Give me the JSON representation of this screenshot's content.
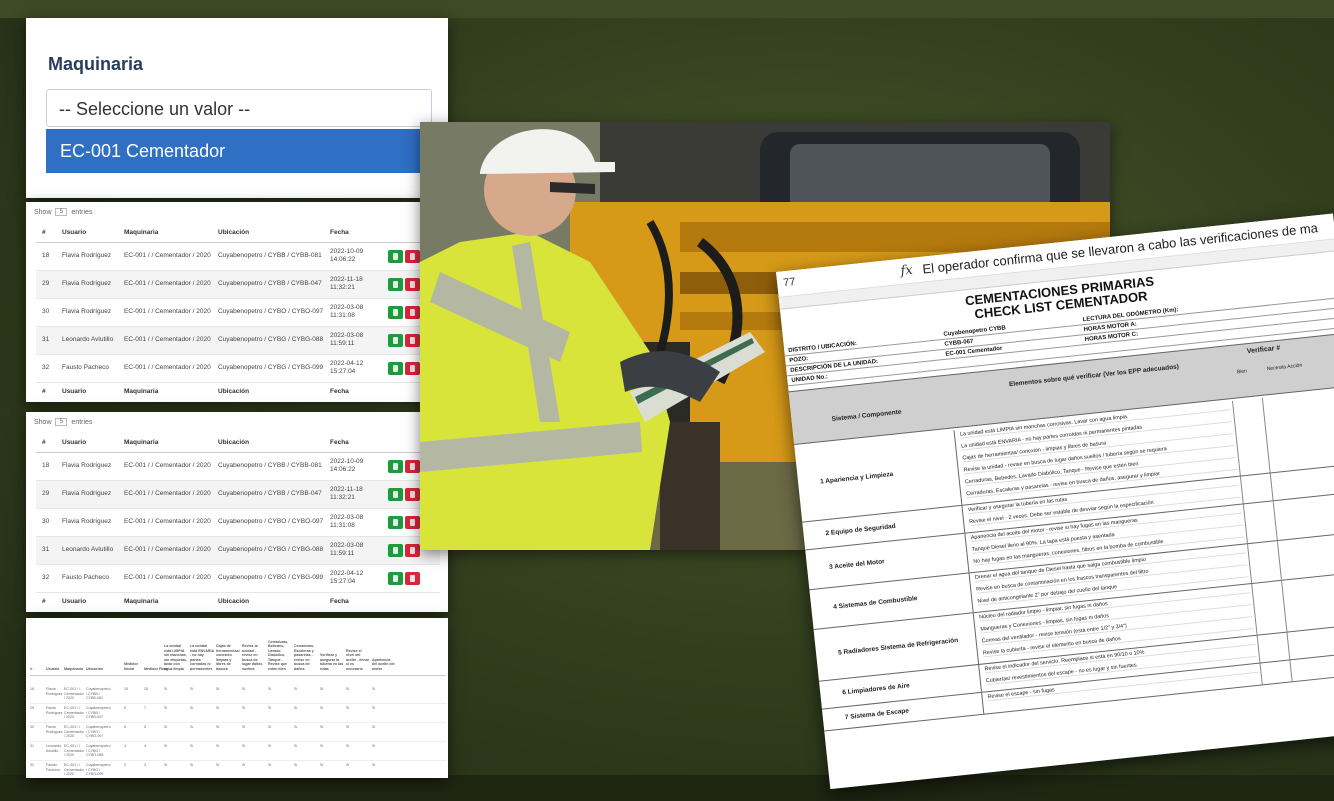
{
  "dropdown": {
    "title": "Maquinaria",
    "placeholder": "-- Seleccione un valor --",
    "option": "EC-001 Cementador"
  },
  "table": {
    "show_label": "Show",
    "show_value": "5",
    "entries_label": "entries",
    "headers": {
      "id": "#",
      "usuario": "Usuario",
      "maquinaria": "Maquinaria",
      "ubicacion": "Ubicación",
      "fecha": "Fecha"
    },
    "rows": [
      {
        "id": "18",
        "usuario": "Flavia Rodríguez",
        "maquinaria": "EC-001 / / Cementador / 2020",
        "ubicacion": "Cuyabenopetro / CYBB / CYBB-081",
        "fecha": "2022-10-09 14:06:22"
      },
      {
        "id": "29",
        "usuario": "Flavia Rodríguez",
        "maquinaria": "EC-001 / / Cementador / 2020",
        "ubicacion": "Cuyabenopetro / CYBB / CYBB-047",
        "fecha": "2022-11-18 11:32:21"
      },
      {
        "id": "30",
        "usuario": "Flavia Rodríguez",
        "maquinaria": "EC-001 / / Cementador / 2020",
        "ubicacion": "Cuyabenopetro / CYBO / CYBO-097",
        "fecha": "2022-03-08 11:31:08"
      },
      {
        "id": "31",
        "usuario": "Leonardo Avlutillo",
        "maquinaria": "EC-001 / / Cementador / 2020",
        "ubicacion": "Cuyabenopetro / CYBG / CYBG-088",
        "fecha": "2022-03-08 11:59:11"
      },
      {
        "id": "32",
        "usuario": "Fausto Pacheco",
        "maquinaria": "EC-001 / / Cementador / 2020",
        "ubicacion": "Cuyabenopetro / CYBG / CYBG-099",
        "fecha": "2022-04-12 15:27:04"
      }
    ]
  },
  "wide_table": {
    "headers": [
      "# ↑",
      "Usuario",
      "Maquinaria",
      "Ubicación",
      "Medidor Inicial",
      "Medidor Final",
      "La unidad está LIMPIA sin manchas, sin etiquetas, lavar con agua limpia",
      "La unidad está ENVARIA - no hay partes corroídas ni permanentes",
      "Cajas de herramientas/ conexión limpias y libres de basura",
      "Revise la unidad - revise en busca de lugar daños sueltos",
      "Cerraduras, Bebedes, Lavado Diabólico, Tanque - Revise que estén bien",
      "Cerraduras, Escaleras y pasarelas - revise en busca de daños",
      "Verificar y asegurar la tubería en las rutas",
      "Revise el nivel del aceite - llenar si es necesario",
      "Apariencia del aceite del motor"
    ],
    "rows": [
      [
        "18",
        "Flavia Rodríguez",
        "EC-001 / / Cementador / 2020",
        "Cuyabenopetro / CYBB / CYBB-081",
        "10",
        "20",
        "Sí",
        "Sí",
        "Sí",
        "Sí",
        "Sí",
        "Sí",
        "Sí",
        "Sí",
        "Sí"
      ],
      [
        "29",
        "Flavia Rodríguez",
        "EC-001 / / Cementador / 2020",
        "Cuyabenopetro / CYBB / CYBB-047",
        "6",
        "7",
        "Sí",
        "Sí",
        "Sí",
        "Sí",
        "Sí",
        "Sí",
        "Sí",
        "Sí",
        "Sí"
      ],
      [
        "30",
        "Flavia Rodríguez",
        "EC-001 / / Cementador / 2020",
        "Cuyabenopetro / CYBO / CYBO-097",
        "6",
        "5",
        "Sí",
        "Sí",
        "Sí",
        "Sí",
        "Sí",
        "Sí",
        "Sí",
        "Sí",
        "Sí"
      ],
      [
        "31",
        "Leonardo Avlutillo",
        "EC-001 / / Cementador / 2020",
        "Cuyabenopetro / CYBG / CYBG-088",
        "4",
        "4",
        "Sí",
        "Sí",
        "Sí",
        "Sí",
        "Sí",
        "Sí",
        "Sí",
        "Sí",
        "Sí"
      ],
      [
        "32",
        "Fausto Pacheco",
        "EC-001 / / Cementador / 2020",
        "Cuyabenopetro / CYBG / CYBG-099",
        "2",
        "3",
        "Sí",
        "Sí",
        "Sí",
        "Sí",
        "Sí",
        "Sí",
        "Sí",
        "Sí",
        "Sí"
      ]
    ]
  },
  "checklist": {
    "cell_ref": "77",
    "fx": "fx",
    "formula": "El operador confirma que se llevaron a cabo las verificaciones de ma",
    "title_line1": "CEMENTACIONES PRIMARIAS",
    "title_line2": "CHECK LIST CEMENTADOR",
    "info": [
      {
        "label": "DISTRITO / UBICACIÓN:",
        "value": "Cuyabenopetro CYBB",
        "right": "LECTURA DEL ODÓMETRO (Km):"
      },
      {
        "label": "POZO:",
        "value": "CYBB-067",
        "right": "HORAS MOTOR A:"
      },
      {
        "label": "DESCRIPCIÓN DE LA UNIDAD:",
        "value": "EC-001 Cementador",
        "right": "HORAS MOTOR C:"
      },
      {
        "label": "UNIDAD No.:",
        "value": "",
        "right": ""
      }
    ],
    "band": {
      "col1": "Sistema / Componente",
      "col2": "Elementos sobre qué verificar (Ver los EPP adecuados)",
      "col3": "Verificar #",
      "col4": "Bien",
      "col5": "Necesita Acción"
    },
    "sections": [
      {
        "label": "1 Apariencia y Limpieza",
        "items": [
          "La unidad está LIMPIA sin manchas corrosivas. Lavar con agua limpia.",
          "La unidad está ENVARIA - no hay partes corroídas ni permanentes pintadas",
          "Cajas de herramientas/ conexión - limpias y libres de basura",
          "Revise la unidad - revise en busca de lugar daños sueltos / tubería según se requiera",
          "Cerraduras, Bebedes, Lavado Diabólico, Tanque - Revise que estén bien",
          "Cerraduras, Escaleras y pasarelas - revise en busca de daños, asegurar y limpiar"
        ]
      },
      {
        "label": "2 Equipo de Seguridad",
        "items": [
          "Verificar y asegurar la tubería en las rutas",
          "Revise el nivel - 2 veces. Debe ser estable de desviar según la especificación"
        ]
      },
      {
        "label": "3 Aceite del Motor",
        "items": [
          "Apariencia del aceite del motor - revise si hay fugas en las mangueras",
          "Tanque Diesel lleno al 90%. La tapa está puesta y asentada",
          "No hay fugas en las mangueras, conexiones, filtros en la bomba de combustible"
        ]
      },
      {
        "label": "4 Sistemas de Combustible",
        "items": [
          "Drenar el agua del tanque de Diesel hasta que salga combustible limpio",
          "Revise en busca de contaminación en los frascos transparentes del filtro",
          "Nivel de anticongelante 2\" por debajo del cuello del tanque"
        ]
      },
      {
        "label": "5 Radiadores Sistema de Refrigeración",
        "items": [
          "Núcleo del radiador limpio - limpiar, sin fugas ni daños",
          "Mangueras y Conexiones - limpias, sin fugas ni daños",
          "Correas del ventilador - revise tensión (está entre 1/2\" y 3/4\")",
          "Revise la cubierta - revise el elemento en busca de daños"
        ]
      },
      {
        "label": "6 Limpiadores de Aire",
        "items": [
          "Revise el indicador del servicio. Reemplace si está en 90/10 o 10%",
          "Cubiertas/ revestimientos del escape - no es lugar y sin fuentes"
        ]
      },
      {
        "label": "7 Sistema de Escape",
        "items": [
          "Revise el escape - sin fugas"
        ]
      }
    ]
  }
}
